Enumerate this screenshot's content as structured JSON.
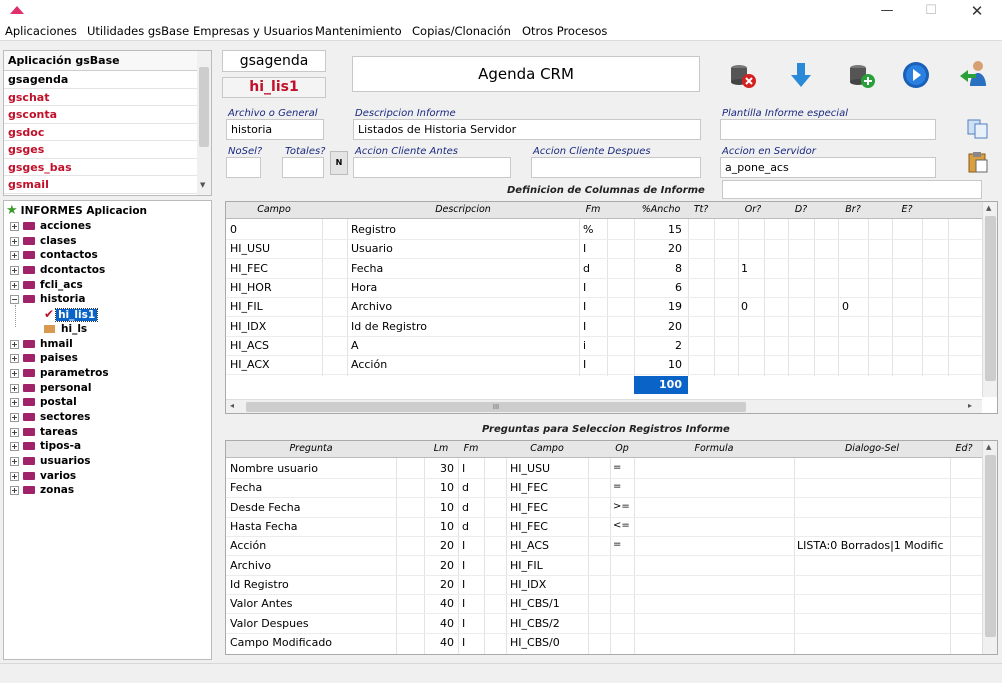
{
  "window": {
    "minimize": "—",
    "maximize": "☐",
    "close": "✕"
  },
  "menu": [
    "Aplicaciones",
    "Utilidades gsBase",
    "Empresas y Usuarios",
    "Mantenimiento",
    "Copias/Clonación",
    "Otros Procesos"
  ],
  "apps": {
    "header": "Aplicación gsBase",
    "items": [
      "gsagenda",
      "gschat",
      "gsconta",
      "gsdoc",
      "gsges",
      "gsges_bas",
      "gsmail"
    ]
  },
  "tree": {
    "root": "INFORMES Aplicacion",
    "nodes": [
      "acciones",
      "clases",
      "contactos",
      "dcontactos",
      "fcli_acs",
      "historia",
      "hi_lis1",
      "hi_ls",
      "hmail",
      "paises",
      "parametros",
      "personal",
      "postal",
      "sectores",
      "tareas",
      "tipos-a",
      "usuarios",
      "varios",
      "zonas"
    ]
  },
  "form": {
    "app": "gsagenda",
    "report": "hi_lis1",
    "title": "Agenda CRM",
    "archivo_label": "Archivo o General",
    "archivo": "historia",
    "descripcion_label": "Descripcion Informe",
    "descripcion": "Listados de Historia Servidor",
    "plantilla_label": "Plantilla Informe especial",
    "plantilla": "",
    "nosel_label": "NoSel?",
    "totales_label": "Totales?",
    "n_btn": "N",
    "accion_antes_label": "Accion Cliente Antes",
    "accion_despues_label": "Accion Cliente Despues",
    "accion_servidor_label": "Accion en Servidor",
    "accion_servidor": "a_pone_acs"
  },
  "columns": {
    "title": "Definicion de Columnas de Informe",
    "headers": [
      "Campo",
      "Descripcion",
      "Fm",
      "%Ancho",
      "Tt?",
      "Or?",
      "D?",
      "Br?",
      "E?"
    ],
    "rows": [
      [
        "0",
        "Registro",
        "%",
        "15",
        "",
        "",
        "",
        "",
        ""
      ],
      [
        "HI_USU",
        "Usuario",
        "I",
        "20",
        "",
        "",
        "",
        "",
        ""
      ],
      [
        "HI_FEC",
        "Fecha",
        "d",
        "8",
        "",
        "1",
        "",
        "",
        ""
      ],
      [
        "HI_HOR",
        "Hora",
        "I",
        "6",
        "",
        "",
        "",
        "",
        ""
      ],
      [
        "HI_FIL",
        "Archivo",
        "I",
        "19",
        "",
        "0",
        "",
        "0",
        ""
      ],
      [
        "HI_IDX",
        "Id de Registro",
        "I",
        "20",
        "",
        "",
        "",
        "",
        ""
      ],
      [
        "HI_ACS",
        "A",
        "i",
        "2",
        "",
        "",
        "",
        "",
        ""
      ],
      [
        "HI_ACX",
        "Acción",
        "I",
        "10",
        "",
        "",
        "",
        "",
        ""
      ]
    ],
    "total": "100",
    "hscroll_thumb": "III"
  },
  "questions": {
    "title": "Preguntas para Seleccion Registros Informe",
    "headers": [
      "Pregunta",
      "Lm",
      "Fm",
      "Campo",
      "Op",
      "Formula",
      "Dialogo-Sel",
      "Ed?"
    ],
    "rows": [
      [
        "Nombre usuario",
        "30",
        "I",
        "HI_USU",
        "=",
        "",
        ""
      ],
      [
        "Fecha",
        "10",
        "d",
        "HI_FEC",
        "=",
        "",
        ""
      ],
      [
        "Desde Fecha",
        "10",
        "d",
        "HI_FEC",
        ">=",
        "",
        ""
      ],
      [
        "Hasta Fecha",
        "10",
        "d",
        "HI_FEC",
        "<=",
        "",
        ""
      ],
      [
        "Acción",
        "20",
        "I",
        "HI_ACS",
        "=",
        "",
        "LISTA:0 Borrados|1 Modific"
      ],
      [
        "Archivo",
        "20",
        "I",
        "HI_FIL",
        "",
        "",
        ""
      ],
      [
        "Id Registro",
        "20",
        "I",
        "HI_IDX",
        "",
        "",
        ""
      ],
      [
        "Valor Antes",
        "40",
        "I",
        "HI_CBS/1",
        "",
        "",
        ""
      ],
      [
        "Valor Despues",
        "40",
        "I",
        "HI_CBS/2",
        "",
        "",
        ""
      ],
      [
        "Campo Modificado",
        "40",
        "I",
        "HI_CBS/0",
        "",
        "",
        ""
      ]
    ]
  },
  "toolbar_icons": [
    "delete-db-icon",
    "download-arrow-icon",
    "add-db-icon",
    "play-icon",
    "user-back-icon",
    "copy-icon",
    "paste-icon"
  ],
  "colors": {
    "accent_red": "#c0102a",
    "selection_blue": "#0a64c8",
    "folder": "#a0236a"
  }
}
